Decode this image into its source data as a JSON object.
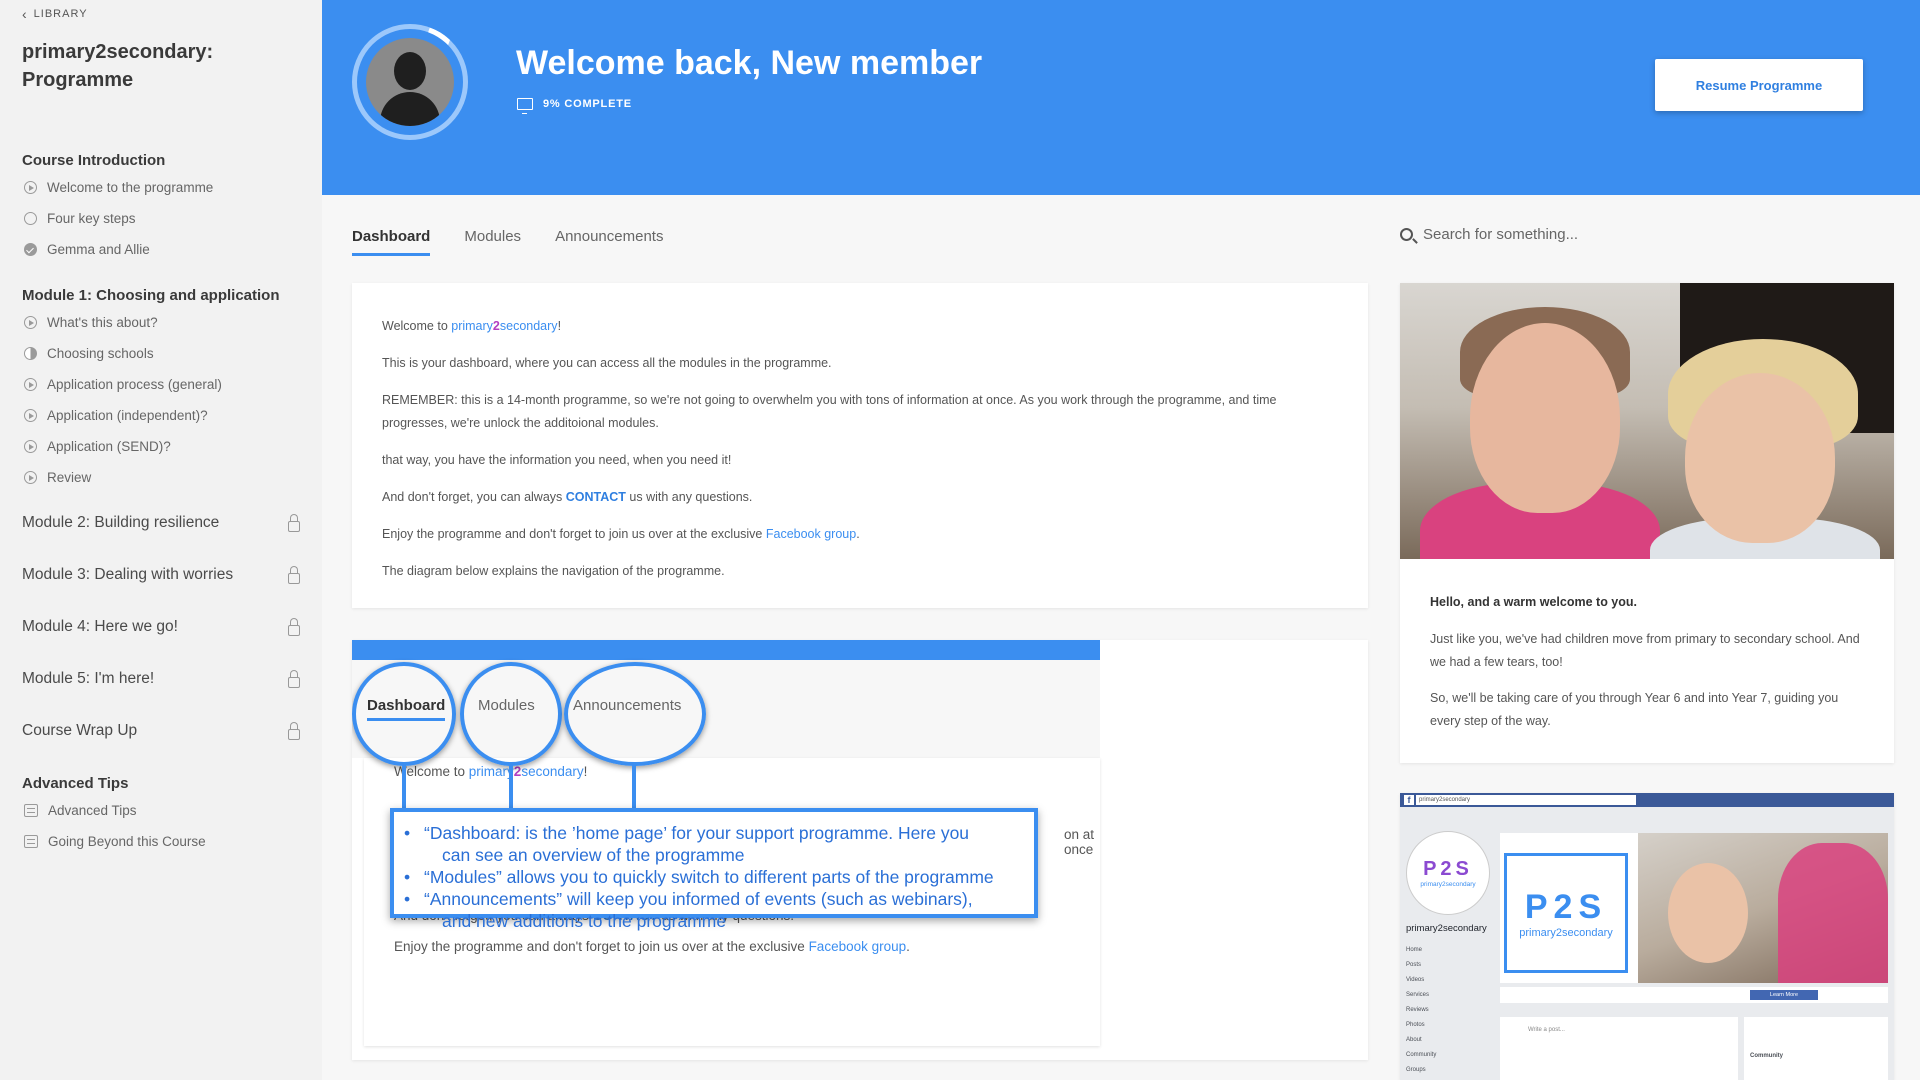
{
  "sidebar": {
    "back_label": "LIBRARY",
    "course_title": "primary2secondary: Programme",
    "sections": [
      {
        "title": "Course Introduction",
        "lessons": [
          "Welcome to the programme",
          "Four key steps",
          "Gemma and Allie"
        ]
      },
      {
        "title": "Module 1: Choosing and application",
        "lessons": [
          "What's this about?",
          "Choosing schools",
          "Application process (general)",
          "Application (independent)?",
          "Application (SEND)?",
          "Review"
        ]
      },
      {
        "title": "Module 2: Building resilience"
      },
      {
        "title": "Module 3: Dealing with worries"
      },
      {
        "title": "Module 4: Here we go!"
      },
      {
        "title": "Module 5: I'm here!"
      },
      {
        "title": "Course Wrap Up"
      },
      {
        "title": "Advanced Tips",
        "lessons": [
          "Advanced Tips",
          "Going Beyond this Course"
        ]
      }
    ]
  },
  "hero": {
    "title": "Welcome back, New member",
    "progress_label": "9% COMPLETE",
    "progress_value": 0.09,
    "resume_label": "Resume Programme"
  },
  "tabs": [
    "Dashboard",
    "Modules",
    "Announcements"
  ],
  "search": {
    "placeholder": "Search for something..."
  },
  "intro": {
    "welcome_prefix": "Welcome to ",
    "brand_a": "primary",
    "brand_2": "2",
    "brand_b": "secondary",
    "welcome_suffix": "!",
    "p1": "This is your dashboard, where you can access all the modules in the programme.",
    "p2": "REMEMBER: this is a 14-month programme, so we're not going to overwhelm you with tons of information at once. As you work through the programme, and time progresses, we're unlock the additoional modules.",
    "p3": "that way, you have the information you need, when you need it!",
    "p4_prefix": "And don't forget, you can always ",
    "p4_contact": "CONTACT",
    "p4_suffix": " us with any questions.",
    "p5_prefix": "Enjoy the programme  and don't forget to join us over at the exclusive ",
    "p5_link": "Facebook group",
    "p5_suffix": ".",
    "p6": "The diagram below explains the navigation of the programme."
  },
  "diagram": {
    "tabs": [
      "Dashboard",
      "Modules",
      "Announcements"
    ],
    "welcome_prefix": "Welcome to ",
    "brand_a": "primary",
    "brand_2": "2",
    "brand_b": "secondary",
    "welcome_suffix": "!",
    "trail": "on at once",
    "contact_prefix": "And don't forget, you can always ",
    "contact_word": "CONTACT",
    "contact_suffix": " us with any questions.",
    "enjoy_prefix": "Enjoy the programme  and don't forget to join us over at the exclusive ",
    "enjoy_link": "Facebook group",
    "enjoy_suffix": ".",
    "callout": [
      {
        "line1": "“Dashboard: is the ’home page’ for your support programme. Here you",
        "line2": "can see an overview of the programme"
      },
      {
        "line1": "“Modules” allows you to quickly switch to different parts of the programme"
      },
      {
        "line1": "“Announcements” will keep you informed of events (such as webinars),",
        "line2": "and new additions to the programme"
      }
    ]
  },
  "welcome_card": {
    "heading": "Hello, and a warm welcome to you.",
    "p1": "Just like you, we've had children move from primary to secondary school. And we had a few tears, too!",
    "p2": "So, we'll be taking care of you through Year 6 and into Year 7, guiding you every step of the way."
  },
  "facebook": {
    "search_text": "primary2secondary",
    "page_name": "primary2secondary",
    "logo_letters": "P2S",
    "logo_sub": "primary2secondary",
    "menu": [
      "Home",
      "Posts",
      "Videos",
      "Services",
      "Reviews",
      "Photos",
      "About",
      "Community",
      "Groups"
    ],
    "learn_more": "Learn More",
    "write_post": "Write a post...",
    "community": "Community"
  },
  "colors": {
    "accent": "#3b8ef0",
    "sidebar_bg": "#f2f2f2",
    "brand_purple": "#b33fc2"
  }
}
